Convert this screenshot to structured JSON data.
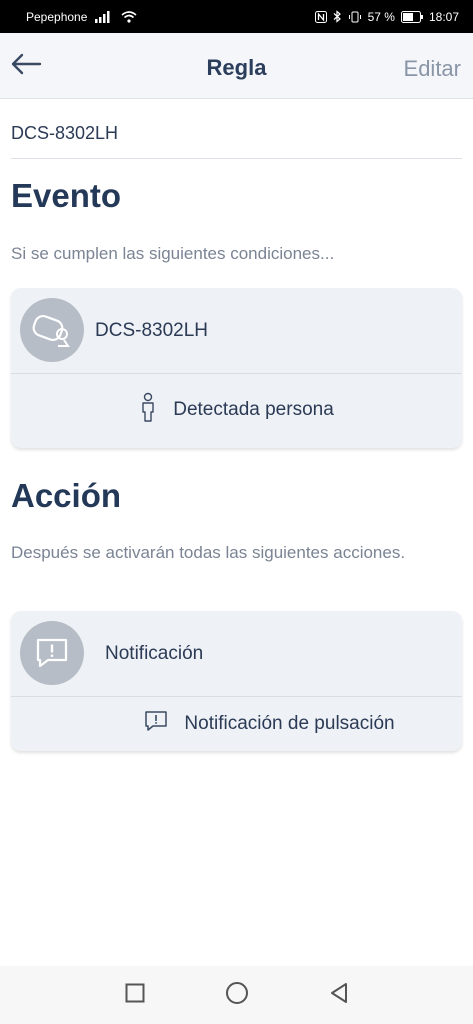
{
  "status_bar": {
    "carrier": "Pepephone",
    "battery_percent": "57 %",
    "time": "18:07"
  },
  "header": {
    "title": "Regla",
    "edit_label": "Editar"
  },
  "device_name": "DCS-8302LH",
  "event": {
    "title": "Evento",
    "subtitle": "Si se cumplen las siguientes condiciones...",
    "card": {
      "device_label": "DCS-8302LH",
      "condition_label": "Detectada persona"
    }
  },
  "action": {
    "title": "Acción",
    "subtitle": "Después se activarán todas las siguientes acciones.",
    "card": {
      "action_label": "Notificación",
      "detail_label": "Notificación de pulsación"
    }
  },
  "icons": {
    "back": "arrow-left-icon",
    "camera": "camera-icon",
    "person": "person-icon",
    "notification": "notification-icon",
    "nav_recent": "square-icon",
    "nav_home": "circle-icon",
    "nav_back": "triangle-back-icon"
  },
  "colors": {
    "title_text": "#243858",
    "header_bg": "#f4f6f9",
    "card_bg": "#eef1f5",
    "icon_circle": "#b7bdc6",
    "edit_text": "#8a96a8"
  }
}
